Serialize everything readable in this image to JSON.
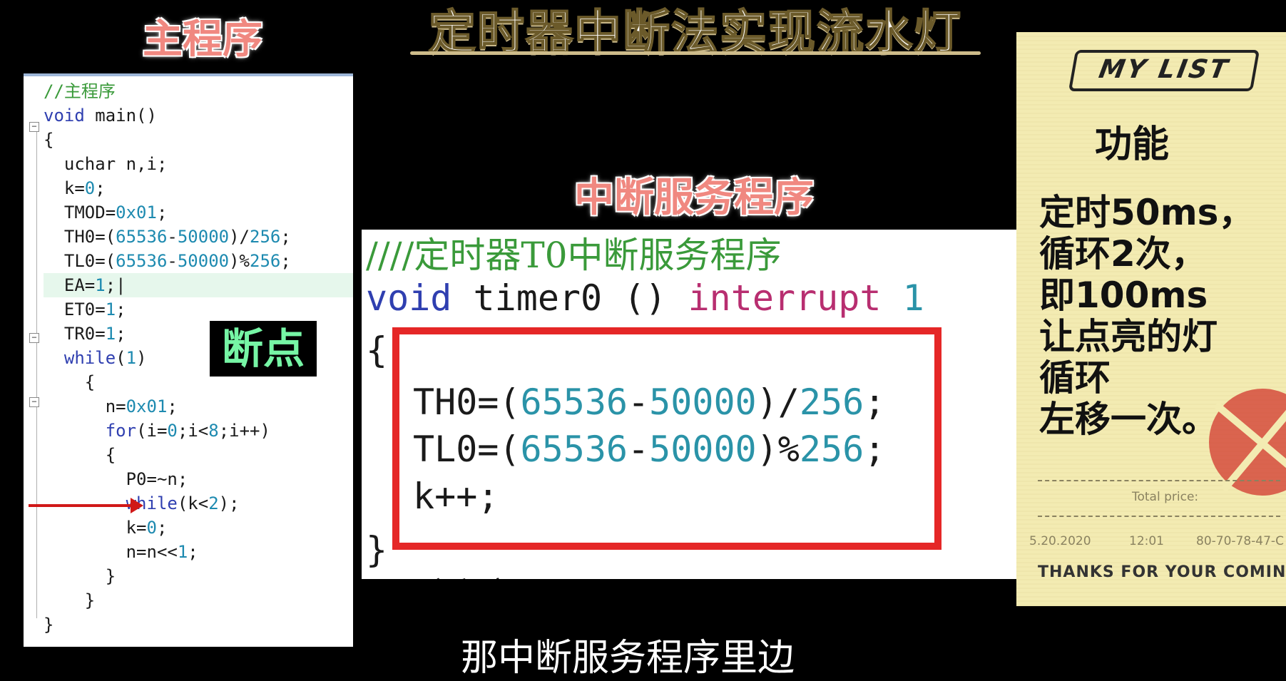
{
  "title": "定时器中断法实现流水灯",
  "labels": {
    "main_program": "主程序",
    "isr": "中断服务程序",
    "breakpoint": "断点"
  },
  "main_code": [
    "//主程序",
    "void main()",
    "{",
    "  uchar n,i;",
    "  k=0;",
    "  TMOD=0x01;",
    "  TH0=(65536-50000)/256;",
    "  TL0=(65536-50000)%256;",
    "  EA=1;",
    "  ET0=1;",
    "  TR0=1;",
    "  while(1)",
    "    {",
    "      n=0x01;",
    "      for(i=0;i<8;i++)",
    "      {",
    "        P0=~n;",
    "        while(k<2);",
    "        k=0;",
    "        n=n<<1;",
    "      }",
    "    }",
    "}"
  ],
  "isr_code": {
    "comment": "////定时器T0中断服务程序",
    "signature": "void timer0 () interrupt 1",
    "open_brace": "{",
    "close_brace": "}",
    "body": [
      "TH0=(65536-50000)/256;",
      "TL0=(65536-50000)%256;",
      "k++;"
    ],
    "cut_text": "主程序"
  },
  "receipt": {
    "header": "MY LIST",
    "heading": "功能",
    "lines": [
      "定时50ms，",
      "循环2次，",
      "即100ms",
      "让点亮的灯",
      "循环",
      "左移一次。"
    ],
    "total_price": "Total price:",
    "date": "5.20.2020",
    "time": "12:01",
    "code": "80-70-78-47-C",
    "thanks": "THANKS FOR YOUR COMING!!"
  },
  "caption": "那中断服务程序里边",
  "colors": {
    "breakpoint_arrow": "#d01818",
    "highlight_box": "#e52727",
    "label_pink": "#f08880",
    "receipt_bg": "#f3ebb2"
  }
}
